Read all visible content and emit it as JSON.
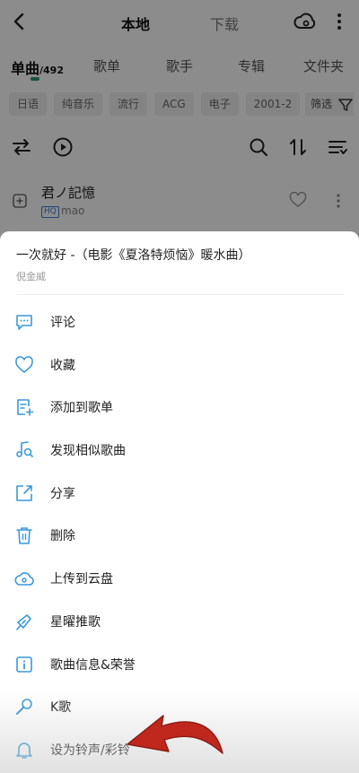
{
  "header": {
    "tab_local": "本地",
    "tab_download": "下载"
  },
  "category_tabs": [
    {
      "label": "单曲",
      "count": "/492"
    },
    {
      "label": "歌单"
    },
    {
      "label": "歌手"
    },
    {
      "label": "专辑"
    },
    {
      "label": "文件夹"
    }
  ],
  "chips": [
    "日语",
    "纯音乐",
    "流行",
    "ACG",
    "电子",
    "2001-2"
  ],
  "filter_label": "筛选",
  "song": {
    "title": "君ノ記憶",
    "badge": "HQ",
    "artist": "mao"
  },
  "sheet": {
    "song_title": "一次就好 -（电影《夏洛特烦恼》暖水曲）",
    "artist": "倪金威",
    "items": [
      {
        "label": "评论",
        "icon": "comment-icon"
      },
      {
        "label": "收藏",
        "icon": "heart-icon"
      },
      {
        "label": "添加到歌单",
        "icon": "add-to-playlist-icon"
      },
      {
        "label": "发现相似歌曲",
        "icon": "similar-songs-icon"
      },
      {
        "label": "分享",
        "icon": "share-icon"
      },
      {
        "label": "删除",
        "icon": "trash-icon"
      },
      {
        "label": "上传到云盘",
        "icon": "cloud-upload-icon"
      },
      {
        "label": "星曜推歌",
        "icon": "star-recommend-icon"
      },
      {
        "label": "歌曲信息&荣誉",
        "icon": "info-icon"
      },
      {
        "label": "K歌",
        "icon": "microphone-icon"
      },
      {
        "label": "设为铃声/彩铃",
        "icon": "bell-icon"
      }
    ]
  },
  "colors": {
    "accent_blue": "#3a9ad9",
    "arrow_red": "#c0281e",
    "tab_indicator": "#2a9d6a"
  }
}
